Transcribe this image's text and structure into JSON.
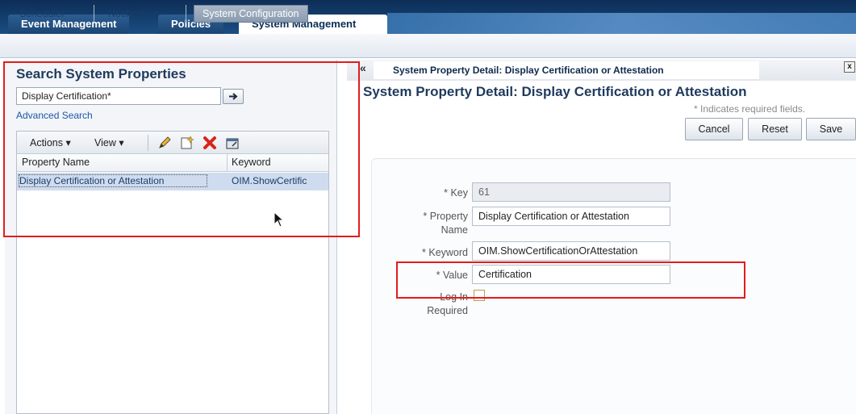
{
  "top_tabs": [
    {
      "label": "Event Management",
      "active": false
    },
    {
      "label": "Policies",
      "active": false
    },
    {
      "label": "System Management",
      "active": true
    }
  ],
  "sub_tabs": [
    {
      "label": "Scheduler",
      "active": false
    },
    {
      "label": "Notification",
      "active": false
    },
    {
      "label": "System Configuration",
      "active": true
    }
  ],
  "search": {
    "title": "Search System Properties",
    "query": "Display Certification*",
    "advanced_link": "Advanced Search",
    "go_icon": "arrow-right-icon"
  },
  "results_toolbar": {
    "actions_label": "Actions ▾",
    "view_label": "View ▾",
    "icons": [
      "edit-pencil-icon",
      "create-new-icon",
      "delete-x-icon",
      "detach-icon"
    ]
  },
  "results_table": {
    "columns": [
      "Property Name",
      "Keyword"
    ],
    "rows": [
      {
        "property_name": "Display Certification or Attestation",
        "keyword": "OIM.ShowCertific"
      }
    ]
  },
  "detail": {
    "tab_label": "System Property Detail: Display Certification or Attestation",
    "collapse_glyph": "«",
    "close_glyph": "x",
    "title": "System Property Detail: Display Certification or Attestation",
    "required_note": "* Indicates required fields.",
    "buttons": {
      "cancel": "Cancel",
      "reset": "Reset",
      "save": "Save"
    },
    "fields": {
      "key_label": "Key",
      "key_value": "61",
      "property_name_label_1": "Property",
      "property_name_label_2": "Name",
      "property_name_value": "Display Certification or Attestation",
      "keyword_label": "Keyword",
      "keyword_value": "OIM.ShowCertificationOrAttestation",
      "value_label": "Value",
      "value_value": "Certification",
      "login_required_label_1": "Log In",
      "login_required_label_2": "Required",
      "required_mark": "*"
    }
  },
  "colors": {
    "annotation_red": "#e31c1c",
    "header_navy": "#14406f",
    "link_blue": "#1d56a8",
    "selected_row": "#cfdcef"
  }
}
